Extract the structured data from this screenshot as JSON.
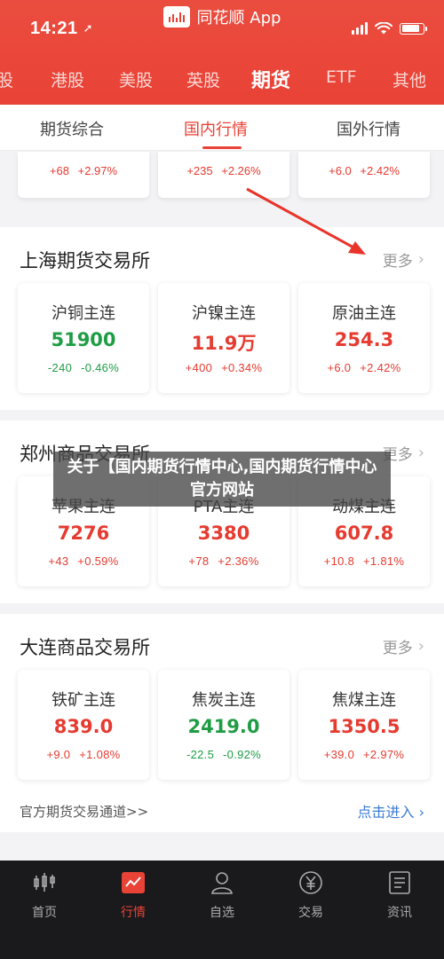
{
  "status": {
    "time": "14:21"
  },
  "app": {
    "name": "同花顺 App"
  },
  "market_tabs": [
    "股",
    "港股",
    "美股",
    "英股",
    "期货",
    "ETF",
    "其他"
  ],
  "sub_tabs": [
    "期货综合",
    "国内行情",
    "国外行情"
  ],
  "top_partial": [
    {
      "change": "+68",
      "pct": "+2.97%",
      "color": "red"
    },
    {
      "change": "+235",
      "pct": "+2.26%",
      "color": "red"
    },
    {
      "change": "+6.0",
      "pct": "+2.42%",
      "color": "red"
    }
  ],
  "sections": [
    {
      "title": "上海期货交易所",
      "more": "更多",
      "cards": [
        {
          "name": "沪铜主连",
          "price": "51900",
          "change": "-240",
          "pct": "-0.46%",
          "color": "green"
        },
        {
          "name": "沪镍主连",
          "price": "11.9万",
          "change": "+400",
          "pct": "+0.34%",
          "color": "red"
        },
        {
          "name": "原油主连",
          "price": "254.3",
          "change": "+6.0",
          "pct": "+2.42%",
          "color": "red"
        }
      ]
    },
    {
      "title": "郑州商品交易所",
      "more": "更多",
      "cards": [
        {
          "name": "苹果主连",
          "price": "7276",
          "change": "+43",
          "pct": "+0.59%",
          "color": "red"
        },
        {
          "name": "PTA主连",
          "price": "3380",
          "change": "+78",
          "pct": "+2.36%",
          "color": "red"
        },
        {
          "name": "动煤主连",
          "price": "607.8",
          "change": "+10.8",
          "pct": "+1.81%",
          "color": "red"
        }
      ]
    },
    {
      "title": "大连商品交易所",
      "more": "更多",
      "cards": [
        {
          "name": "铁矿主连",
          "price": "839.0",
          "change": "+9.0",
          "pct": "+1.08%",
          "color": "red"
        },
        {
          "name": "焦炭主连",
          "price": "2419.0",
          "change": "-22.5",
          "pct": "-0.92%",
          "color": "green"
        },
        {
          "name": "焦煤主连",
          "price": "1350.5",
          "change": "+39.0",
          "pct": "+2.97%",
          "color": "red"
        }
      ]
    }
  ],
  "footer": {
    "left": "官方期货交易通道>>",
    "right": "点击进入"
  },
  "overlay": {
    "text": "关于【国内期货行情中心,国内期货行情中心官方网站"
  },
  "bottom_nav": [
    {
      "label": "首页",
      "icon": "home-chart-icon"
    },
    {
      "label": "行情",
      "icon": "market-chart-icon"
    },
    {
      "label": "自选",
      "icon": "user-icon"
    },
    {
      "label": "交易",
      "icon": "yuan-icon"
    },
    {
      "label": "资讯",
      "icon": "news-icon"
    }
  ],
  "colors": {
    "accent": "#e94236",
    "up": "#e53b30",
    "down": "#1f9d45",
    "link": "#3a7bd5"
  }
}
